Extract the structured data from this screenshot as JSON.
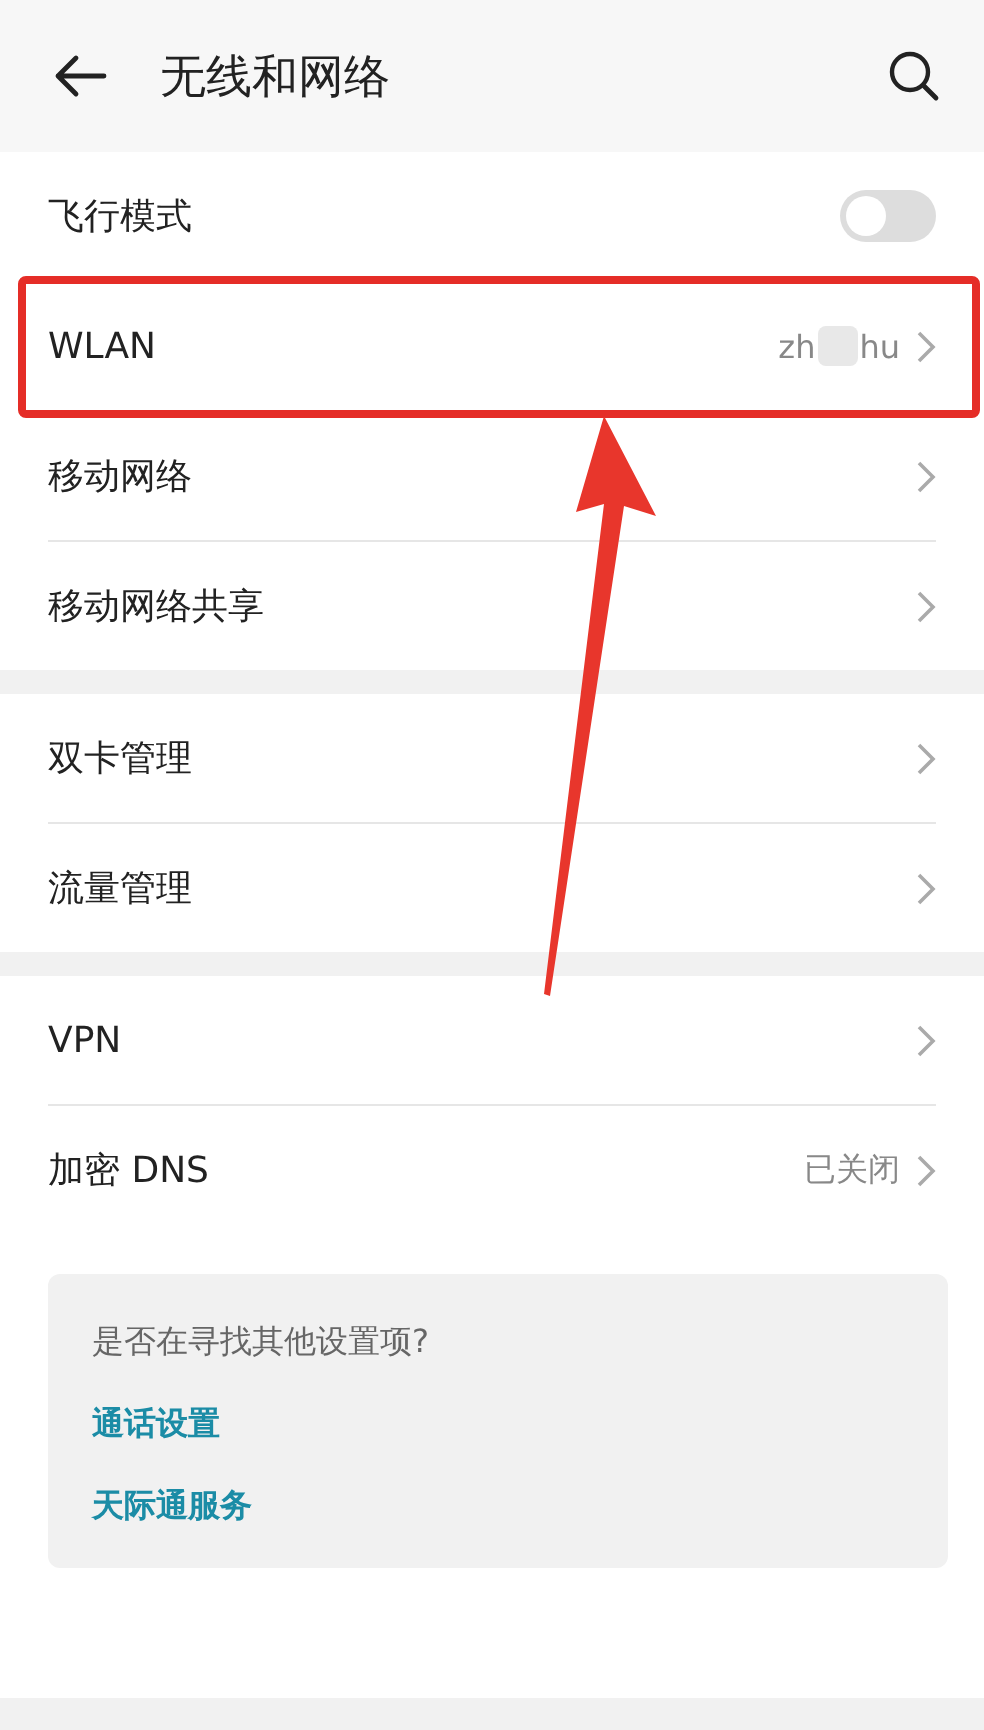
{
  "header": {
    "title": "无线和网络"
  },
  "groups": [
    {
      "items": [
        {
          "kind": "toggle",
          "label": "飞行模式",
          "on": false,
          "highlighted": false
        },
        {
          "kind": "link",
          "label": "WLAN",
          "value": [
            "zh",
            "hu"
          ],
          "highlighted": true
        },
        {
          "kind": "link",
          "label": "移动网络",
          "highlighted": false
        },
        {
          "kind": "link",
          "label": "移动网络共享",
          "highlighted": false
        }
      ]
    },
    {
      "items": [
        {
          "kind": "link",
          "label": "双卡管理",
          "highlighted": false
        },
        {
          "kind": "link",
          "label": "流量管理",
          "highlighted": false
        }
      ]
    },
    {
      "items": [
        {
          "kind": "link",
          "label": "VPN",
          "highlighted": false
        },
        {
          "kind": "link",
          "label": "加密 DNS",
          "value": [
            "已关闭"
          ],
          "highlighted": false
        }
      ]
    }
  ],
  "suggestions": {
    "question": "是否在寻找其他设置项?",
    "links": [
      "通话设置",
      "天际通服务"
    ]
  },
  "annotation_arrow": true
}
